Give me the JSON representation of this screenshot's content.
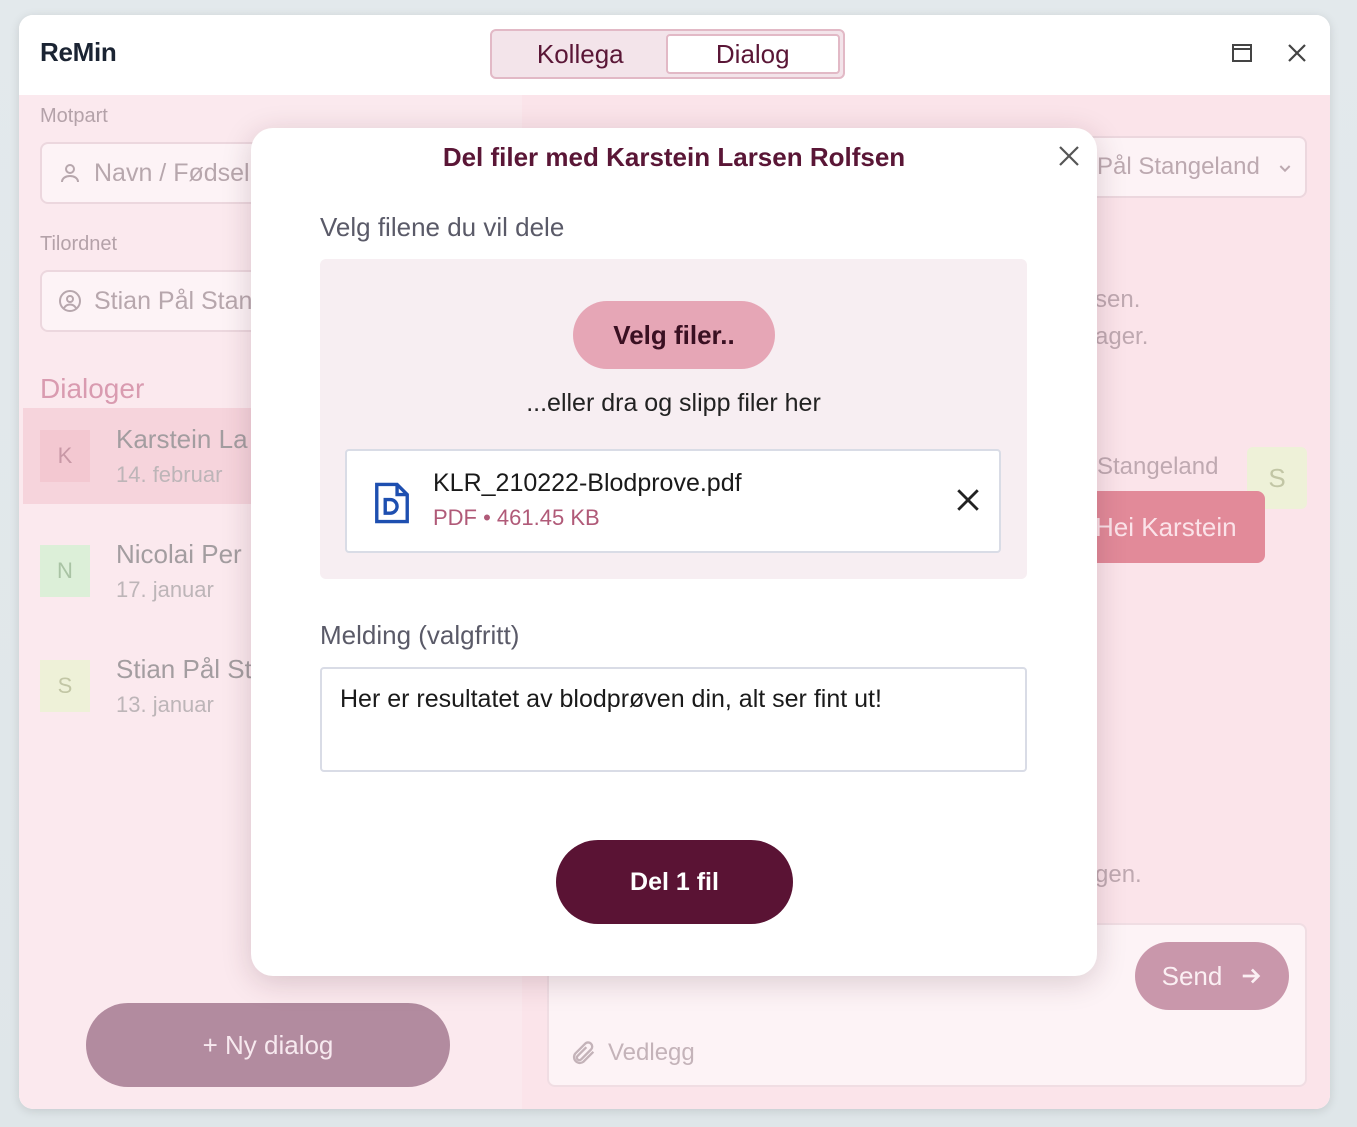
{
  "app": {
    "title": "ReMin",
    "tabs": [
      "Kollega",
      "Dialog"
    ],
    "active_tab": "Dialog"
  },
  "sidebar": {
    "motpart_label": "Motpart",
    "motpart_placeholder": "Navn / Fødsel",
    "tilordnet_label": "Tilordnet",
    "tilordnet_value": "Stian Pål Stan",
    "dialogs_heading": "Dialoger",
    "dialogs": [
      {
        "initial": "K",
        "name": "Karstein La",
        "date": "14. februar",
        "avatar_bg": "#f3c8d1",
        "avatar_fg": "#c898a6"
      },
      {
        "initial": "N",
        "name": "Nicolai Per",
        "date": "17. januar",
        "avatar_bg": "#dcefd8",
        "avatar_fg": "#a9c3a4"
      },
      {
        "initial": "S",
        "name": "Stian Pål St",
        "date": "13. januar",
        "avatar_bg": "#eef1d8",
        "avatar_fg": "#c2c6a5"
      }
    ],
    "new_dialog_label": "+ Ny dialog"
  },
  "main": {
    "assignee_select": "Pål Stangeland",
    "text_fragment_1": "sen.",
    "text_fragment_2": "ager.",
    "sender_name": "Stangeland",
    "sender_initial": "S",
    "bubble_text": "Hei Karstein",
    "text_fragment_3": "gen.",
    "send_label": "Send",
    "attachment_label": "Vedlegg"
  },
  "modal": {
    "title": "Del filer med Karstein Larsen Rolfsen",
    "choose_section_label": "Velg filene du vil dele",
    "choose_button": "Velg filer..",
    "drop_hint": "...eller dra og slipp filer her",
    "file": {
      "name": "KLR_210222-Blodprove.pdf",
      "type": "PDF",
      "size": "461.45 KB",
      "meta": "PDF • 461.45 KB"
    },
    "message_label": "Melding (valgfritt)",
    "message_value": "Her er resultatet av blodprøven din, alt ser fint ut!",
    "share_button": "Del 1 fil"
  },
  "colors": {
    "brand": "#5a1334",
    "accent_pink": "#e6a6b6",
    "file_icon": "#1e4fb0"
  }
}
